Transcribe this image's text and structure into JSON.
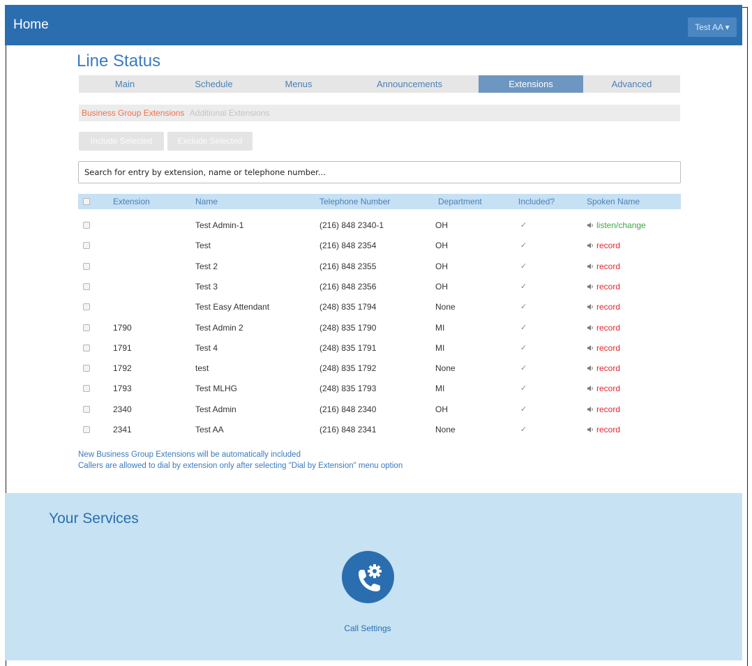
{
  "header": {
    "home_label": "Home",
    "user_label": "Test AA ▾"
  },
  "page_title": "Line Status",
  "tabs": [
    {
      "label": "Main",
      "active": false
    },
    {
      "label": "Schedule",
      "active": false
    },
    {
      "label": "Menus",
      "active": false
    },
    {
      "label": "Announcements",
      "active": false
    },
    {
      "label": "Extensions",
      "active": true
    },
    {
      "label": "Advanced",
      "active": false
    }
  ],
  "subtabs": {
    "active": "Business Group Extensions",
    "other": "Additional Extensions"
  },
  "actions": {
    "include": "Include Selected",
    "exclude": "Exclude Selected"
  },
  "search": {
    "placeholder": "Search for entry by extension, name or telephone number..."
  },
  "table": {
    "headers": {
      "extension": "Extension",
      "name": "Name",
      "phone": "Telephone Number",
      "department": "Department",
      "included": "Included?",
      "spoken": "Spoken Name"
    },
    "rows": [
      {
        "extension": "",
        "name": "Test Admin-1",
        "phone": "(216) 848 2340-1",
        "department": "OH",
        "included": "✓",
        "spoken": "listen/change"
      },
      {
        "extension": "",
        "name": "Test",
        "phone": "(216) 848 2354",
        "department": "OH",
        "included": "✓",
        "spoken": "record"
      },
      {
        "extension": "",
        "name": "Test 2",
        "phone": "(216) 848 2355",
        "department": "OH",
        "included": "✓",
        "spoken": "record"
      },
      {
        "extension": "",
        "name": "Test 3",
        "phone": "(216) 848 2356",
        "department": "OH",
        "included": "✓",
        "spoken": "record"
      },
      {
        "extension": "",
        "name": "Test Easy Attendant",
        "phone": "(248) 835 1794",
        "department": "None",
        "included": "✓",
        "spoken": "record"
      },
      {
        "extension": "1790",
        "name": "Test Admin 2",
        "phone": "(248) 835 1790",
        "department": "MI",
        "included": "✓",
        "spoken": "record"
      },
      {
        "extension": "1791",
        "name": "Test 4",
        "phone": "(248) 835 1791",
        "department": "MI",
        "included": "✓",
        "spoken": "record"
      },
      {
        "extension": "1792",
        "name": "test",
        "phone": "(248) 835 1792",
        "department": "None",
        "included": "✓",
        "spoken": "record"
      },
      {
        "extension": "1793",
        "name": "Test MLHG",
        "phone": "(248) 835 1793",
        "department": "MI",
        "included": "✓",
        "spoken": "record"
      },
      {
        "extension": "2340",
        "name": "Test Admin",
        "phone": "(216) 848 2340",
        "department": "OH",
        "included": "✓",
        "spoken": "record"
      },
      {
        "extension": "2341",
        "name": "Test AA",
        "phone": "(216) 848 2341",
        "department": "None",
        "included": "✓",
        "spoken": "record"
      }
    ]
  },
  "notes": {
    "line1": "New Business Group Extensions will be automatically included",
    "line2": "Callers are allowed to dial by extension only after selecting \"Dial by Extension\" menu option"
  },
  "services": {
    "title": "Your Services",
    "call_settings_label": "Call Settings",
    "call_settings_icon": "phone-gear-icon"
  },
  "colors": {
    "brand_blue": "#2a6eb0",
    "active_tab": "#6d96c1",
    "link_green": "#3fa54a",
    "link_red": "#e8252b",
    "subtab_active": "#f0724a",
    "services_bg": "#c7e2f3"
  }
}
